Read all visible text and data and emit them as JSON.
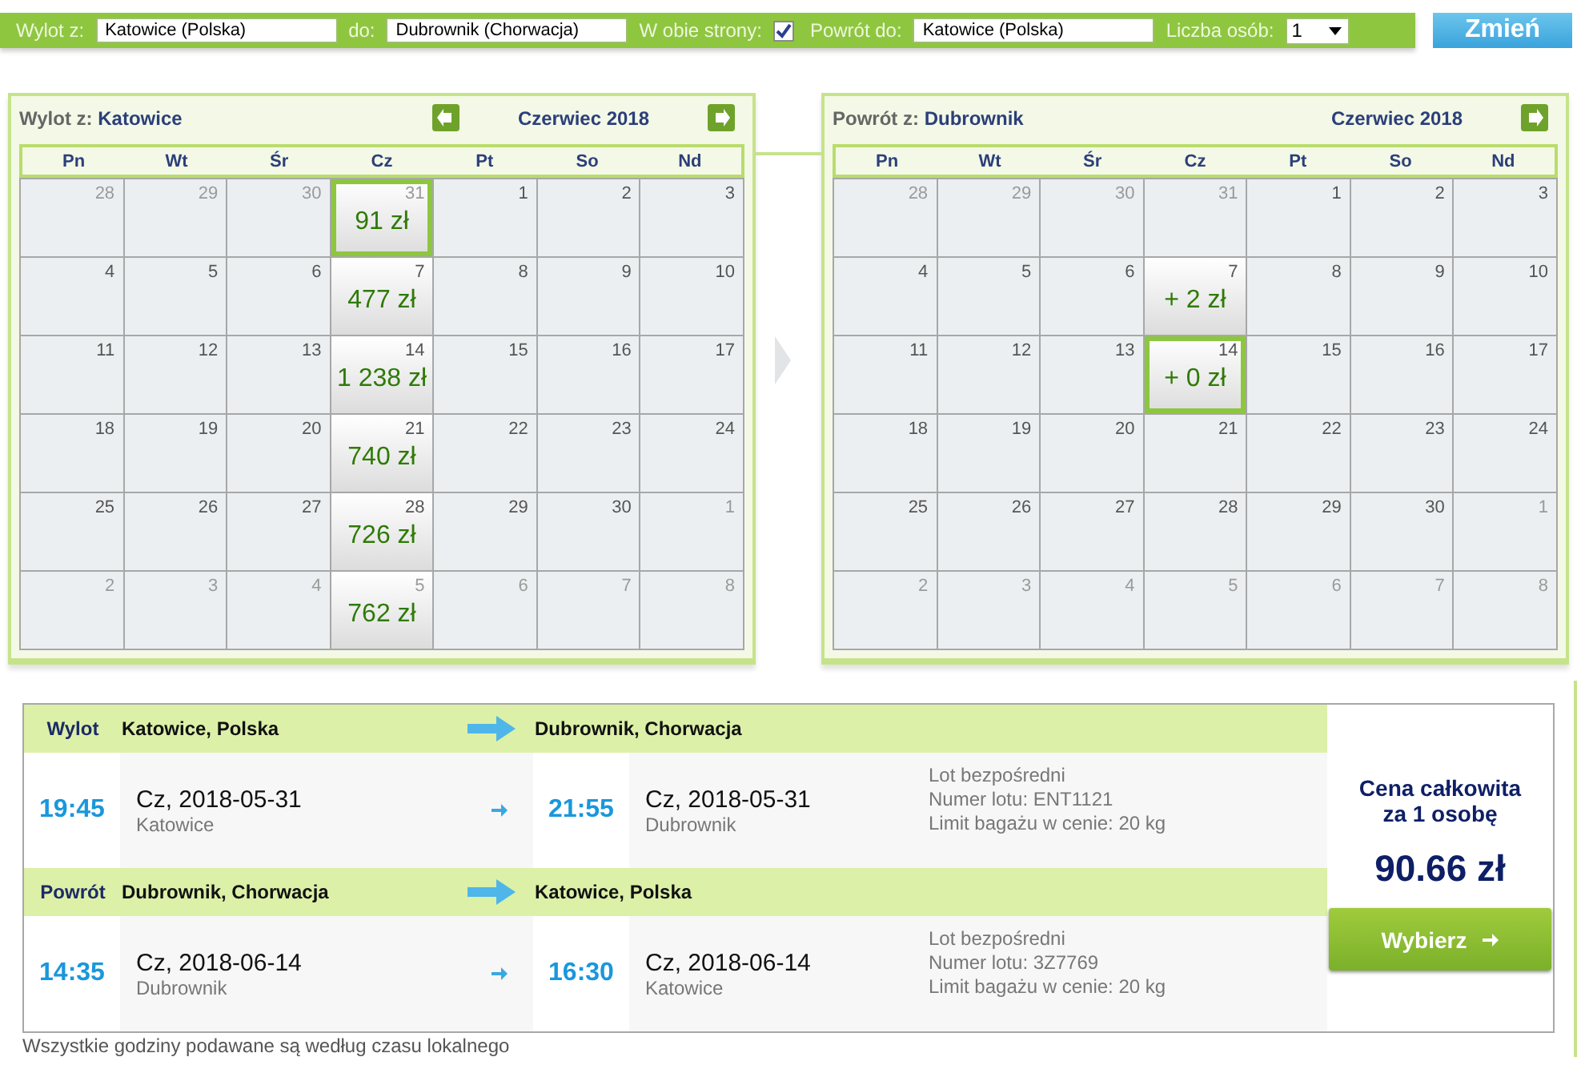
{
  "search_bar": {
    "fields": [
      {
        "kind": "text",
        "label": "Wylot z:",
        "value": "Katowice (Polska)"
      },
      {
        "kind": "text",
        "label": "do:",
        "value": "Dubrownik (Chorwacja)"
      },
      {
        "kind": "checkbox",
        "label": "W obie strony:",
        "checked": true
      },
      {
        "kind": "text",
        "label": "Powrót do:",
        "value": "Katowice (Polska)"
      },
      {
        "kind": "select",
        "label": "Liczba osób:",
        "value": "1"
      }
    ],
    "button": "Zmień"
  },
  "calendars": [
    {
      "label": "Wylot z:",
      "city": "Katowice",
      "month": "Czerwiec 2018",
      "prev": true,
      "next": true,
      "weekdays": [
        "Pn",
        "Wt",
        "Śr",
        "Cz",
        "Pt",
        "So",
        "Nd"
      ],
      "weeks": [
        [
          {
            "day": "28",
            "muted": true,
            "selected": false
          },
          {
            "day": "29",
            "muted": true,
            "selected": false
          },
          {
            "day": "30",
            "muted": true,
            "selected": false
          },
          {
            "day": "31",
            "muted": true,
            "price": "91 zł",
            "selected": true
          },
          {
            "day": "1",
            "muted": false,
            "selected": false
          },
          {
            "day": "2",
            "muted": false,
            "selected": false
          },
          {
            "day": "3",
            "muted": false,
            "selected": false
          }
        ],
        [
          {
            "day": "4",
            "muted": false,
            "selected": false
          },
          {
            "day": "5",
            "muted": false,
            "selected": false
          },
          {
            "day": "6",
            "muted": false,
            "selected": false
          },
          {
            "day": "7",
            "muted": false,
            "price": "477 zł",
            "selected": false
          },
          {
            "day": "8",
            "muted": false,
            "selected": false
          },
          {
            "day": "9",
            "muted": false,
            "selected": false
          },
          {
            "day": "10",
            "muted": false,
            "selected": false
          }
        ],
        [
          {
            "day": "11",
            "muted": false,
            "selected": false
          },
          {
            "day": "12",
            "muted": false,
            "selected": false
          },
          {
            "day": "13",
            "muted": false,
            "selected": false
          },
          {
            "day": "14",
            "muted": false,
            "price": "1 238 zł",
            "selected": false
          },
          {
            "day": "15",
            "muted": false,
            "selected": false
          },
          {
            "day": "16",
            "muted": false,
            "selected": false
          },
          {
            "day": "17",
            "muted": false,
            "selected": false
          }
        ],
        [
          {
            "day": "18",
            "muted": false,
            "selected": false
          },
          {
            "day": "19",
            "muted": false,
            "selected": false
          },
          {
            "day": "20",
            "muted": false,
            "selected": false
          },
          {
            "day": "21",
            "muted": false,
            "price": "740 zł",
            "selected": false
          },
          {
            "day": "22",
            "muted": false,
            "selected": false
          },
          {
            "day": "23",
            "muted": false,
            "selected": false
          },
          {
            "day": "24",
            "muted": false,
            "selected": false
          }
        ],
        [
          {
            "day": "25",
            "muted": false,
            "selected": false
          },
          {
            "day": "26",
            "muted": false,
            "selected": false
          },
          {
            "day": "27",
            "muted": false,
            "selected": false
          },
          {
            "day": "28",
            "muted": false,
            "price": "726 zł",
            "selected": false
          },
          {
            "day": "29",
            "muted": false,
            "selected": false
          },
          {
            "day": "30",
            "muted": false,
            "selected": false
          },
          {
            "day": "1",
            "muted": true,
            "selected": false
          }
        ],
        [
          {
            "day": "2",
            "muted": true,
            "selected": false
          },
          {
            "day": "3",
            "muted": true,
            "selected": false
          },
          {
            "day": "4",
            "muted": true,
            "selected": false
          },
          {
            "day": "5",
            "muted": true,
            "price": "762 zł",
            "selected": false
          },
          {
            "day": "6",
            "muted": true,
            "selected": false
          },
          {
            "day": "7",
            "muted": true,
            "selected": false
          },
          {
            "day": "8",
            "muted": true,
            "selected": false
          }
        ]
      ]
    },
    {
      "label": "Powrót z:",
      "city": "Dubrownik",
      "month": "Czerwiec 2018",
      "prev": false,
      "next": true,
      "weekdays": [
        "Pn",
        "Wt",
        "Śr",
        "Cz",
        "Pt",
        "So",
        "Nd"
      ],
      "weeks": [
        [
          {
            "day": "28",
            "muted": true,
            "selected": false
          },
          {
            "day": "29",
            "muted": true,
            "selected": false
          },
          {
            "day": "30",
            "muted": true,
            "selected": false
          },
          {
            "day": "31",
            "muted": true,
            "selected": false
          },
          {
            "day": "1",
            "muted": false,
            "selected": false
          },
          {
            "day": "2",
            "muted": false,
            "selected": false
          },
          {
            "day": "3",
            "muted": false,
            "selected": false
          }
        ],
        [
          {
            "day": "4",
            "muted": false,
            "selected": false
          },
          {
            "day": "5",
            "muted": false,
            "selected": false
          },
          {
            "day": "6",
            "muted": false,
            "selected": false
          },
          {
            "day": "7",
            "muted": false,
            "price": "+ 2 zł",
            "selected": false
          },
          {
            "day": "8",
            "muted": false,
            "selected": false
          },
          {
            "day": "9",
            "muted": false,
            "selected": false
          },
          {
            "day": "10",
            "muted": false,
            "selected": false
          }
        ],
        [
          {
            "day": "11",
            "muted": false,
            "selected": false
          },
          {
            "day": "12",
            "muted": false,
            "selected": false
          },
          {
            "day": "13",
            "muted": false,
            "selected": false
          },
          {
            "day": "14",
            "muted": false,
            "price": "+ 0 zł",
            "selected": true
          },
          {
            "day": "15",
            "muted": false,
            "selected": false
          },
          {
            "day": "16",
            "muted": false,
            "selected": false
          },
          {
            "day": "17",
            "muted": false,
            "selected": false
          }
        ],
        [
          {
            "day": "18",
            "muted": false,
            "selected": false
          },
          {
            "day": "19",
            "muted": false,
            "selected": false
          },
          {
            "day": "20",
            "muted": false,
            "selected": false
          },
          {
            "day": "21",
            "muted": false,
            "selected": false
          },
          {
            "day": "22",
            "muted": false,
            "selected": false
          },
          {
            "day": "23",
            "muted": false,
            "selected": false
          },
          {
            "day": "24",
            "muted": false,
            "selected": false
          }
        ],
        [
          {
            "day": "25",
            "muted": false,
            "selected": false
          },
          {
            "day": "26",
            "muted": false,
            "selected": false
          },
          {
            "day": "27",
            "muted": false,
            "selected": false
          },
          {
            "day": "28",
            "muted": false,
            "selected": false
          },
          {
            "day": "29",
            "muted": false,
            "selected": false
          },
          {
            "day": "30",
            "muted": false,
            "selected": false
          },
          {
            "day": "1",
            "muted": true,
            "selected": false
          }
        ],
        [
          {
            "day": "2",
            "muted": true,
            "selected": false
          },
          {
            "day": "3",
            "muted": true,
            "selected": false
          },
          {
            "day": "4",
            "muted": true,
            "selected": false
          },
          {
            "day": "5",
            "muted": true,
            "selected": false
          },
          {
            "day": "6",
            "muted": true,
            "selected": false
          },
          {
            "day": "7",
            "muted": true,
            "selected": false
          },
          {
            "day": "8",
            "muted": true,
            "selected": false
          }
        ]
      ]
    }
  ],
  "flight": {
    "legs": [
      {
        "label": "Wylot",
        "from": "Katowice, Polska",
        "to": "Dubrownik, Chorwacja",
        "dep_time": "19:45",
        "dep_date": "Cz, 2018-05-31",
        "dep_city": "Katowice",
        "arr_time": "21:55",
        "arr_date": "Cz, 2018-05-31",
        "arr_city": "Dubrownik",
        "info": [
          "Lot bezpośredni",
          "Numer lotu: ENT1121",
          "Limit bagażu w cenie: 20 kg"
        ]
      },
      {
        "label": "Powrót",
        "from": "Dubrownik, Chorwacja",
        "to": "Katowice, Polska",
        "dep_time": "14:35",
        "dep_date": "Cz, 2018-06-14",
        "dep_city": "Dubrownik",
        "arr_time": "16:30",
        "arr_date": "Cz, 2018-06-14",
        "arr_city": "Katowice",
        "info": [
          "Lot bezpośredni",
          "Numer lotu: 3Z7769",
          "Limit bagażu w cenie: 20 kg"
        ]
      }
    ],
    "price_title": "Cena całkowita za 1 osobę",
    "price": "90.66 zł",
    "button": "Wybierz"
  },
  "footnote": "Wszystkie godziny podawane są według czasu lokalnego"
}
